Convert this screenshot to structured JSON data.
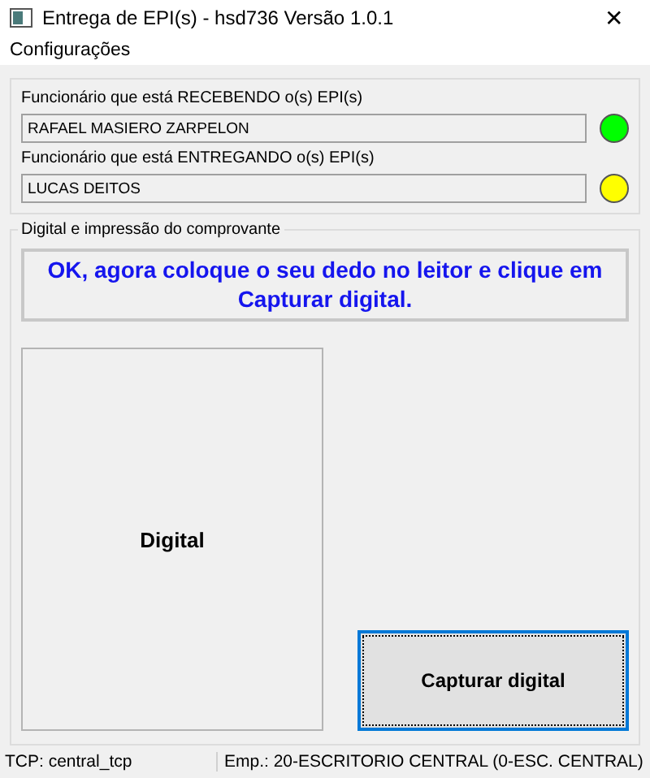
{
  "window": {
    "title": "Entrega de EPI(s) - hsd736 Versão 1.0.1",
    "close": "✕"
  },
  "menu": [
    "Configurações"
  ],
  "employees": [
    {
      "label": "Funcionário que está RECEBENDO o(s) EPI(s)",
      "value": "RAFAEL MASIERO ZARPELON",
      "color": "#00ff00"
    },
    {
      "label": "Funcionário que está ENTREGANDO o(s) EPI(s)",
      "value": "LUCAS DEITOS",
      "color": "#ffff00"
    }
  ],
  "digital_group": {
    "title": "Digital e impressão do comprovante",
    "message": "OK, agora coloque o seu dedo no leitor e clique em Capturar digital.",
    "fingerprint_label": "Digital",
    "capture_button": "Capturar digital"
  },
  "status_bar": [
    "TCP: central_tcp",
    "Emp.: 20-ESCRITORIO CENTRAL (0-ESC. CENTRAL)"
  ]
}
